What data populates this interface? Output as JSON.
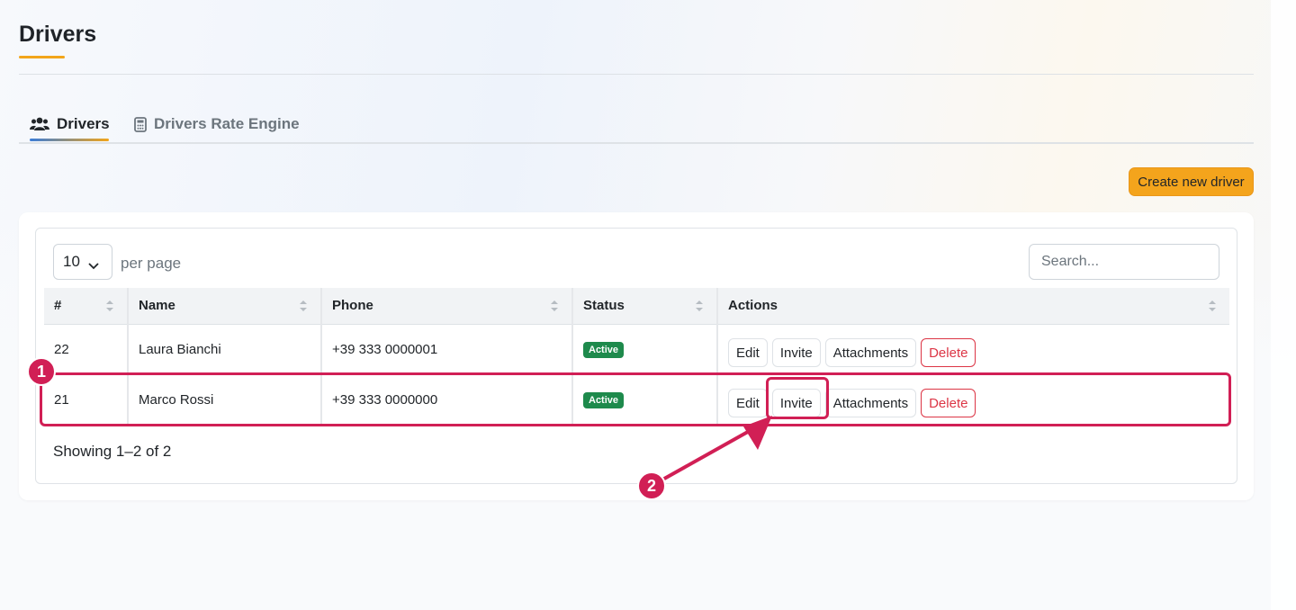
{
  "page": {
    "title": "Drivers"
  },
  "tabs": [
    {
      "label": "Drivers",
      "icon": "users-icon",
      "active": true
    },
    {
      "label": "Drivers Rate Engine",
      "icon": "calculator-icon",
      "active": false
    }
  ],
  "toolbar": {
    "create_label": "Create new driver"
  },
  "table_controls": {
    "per_page_value": "10",
    "per_page_label": "per page",
    "search_placeholder": "Search..."
  },
  "table": {
    "columns": [
      "#",
      "Name",
      "Phone",
      "Status",
      "Actions"
    ],
    "rows": [
      {
        "id": "22",
        "name": "Laura Bianchi",
        "phone": "+39 333 0000001",
        "status": "Active"
      },
      {
        "id": "21",
        "name": "Marco Rossi",
        "phone": "+39 333 0000000",
        "status": "Active"
      }
    ],
    "action_labels": {
      "edit": "Edit",
      "invite": "Invite",
      "attachments": "Attachments",
      "delete": "Delete"
    }
  },
  "footer": {
    "showing": "Showing 1–2 of 2"
  },
  "annotations": {
    "marker_1": "1",
    "marker_2": "2",
    "color": "#d11f55"
  },
  "colors": {
    "accent": "#f4a41c",
    "active_badge": "#1e8a4c",
    "danger": "#dc3545"
  }
}
